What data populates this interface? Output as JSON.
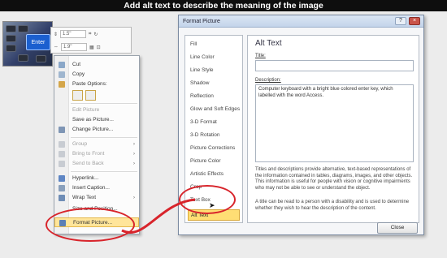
{
  "banner": {
    "text": "Add alt text to describe the meaning of the image"
  },
  "mini_toolbar": {
    "height_value": "1.5\"",
    "width_value": "1.9\""
  },
  "photo": {
    "enter_key_label": "Enter"
  },
  "context_menu": {
    "paste_options_label": "Paste Options:",
    "items": [
      {
        "label": "Cut",
        "disabled": false
      },
      {
        "label": "Copy",
        "disabled": false
      },
      {
        "label": "Edit Picture",
        "disabled": true
      },
      {
        "label": "Save as Picture...",
        "disabled": false
      },
      {
        "label": "Change Picture...",
        "disabled": false
      },
      {
        "label": "Group",
        "disabled": true,
        "submenu": true
      },
      {
        "label": "Bring to Front",
        "disabled": true,
        "submenu": true
      },
      {
        "label": "Send to Back",
        "disabled": true,
        "submenu": true
      },
      {
        "label": "Hyperlink...",
        "disabled": false
      },
      {
        "label": "Insert Caption...",
        "disabled": false
      },
      {
        "label": "Wrap Text",
        "disabled": false,
        "submenu": true
      },
      {
        "label": "Size and Position...",
        "disabled": false
      },
      {
        "label": "Format Picture...",
        "disabled": false,
        "highlighted": true
      }
    ]
  },
  "dialog": {
    "title": "Format Picture",
    "nav": [
      "Fill",
      "Line Color",
      "Line Style",
      "Shadow",
      "Reflection",
      "Glow and Soft Edges",
      "3-D Format",
      "3-D Rotation",
      "Picture Corrections",
      "Picture Color",
      "Artistic Effects",
      "Crop",
      "Text Box",
      "Alt Text"
    ],
    "selected_nav": "Alt Text",
    "pane_title": "Alt Text",
    "title_label": "Title:",
    "title_value": "",
    "description_label": "Description:",
    "description_value": "Computer keyboard with a bright blue colored enter key, which labelled with the word Access.",
    "help_1": "Titles and descriptions provide alternative, text-based representations of the information contained in tables, diagrams, images, and other objects. This information is useful for people with vision or cognitive impairments who may not be able to see or understand the object.",
    "help_2": "A title can be read to a person with a disability and is used to determine whether they wish to hear the description of the content.",
    "close_label": "Close"
  },
  "colors": {
    "highlight_ring": "#d8242b",
    "selection": "#ffde74",
    "banner_bg": "#0e0e0e"
  }
}
